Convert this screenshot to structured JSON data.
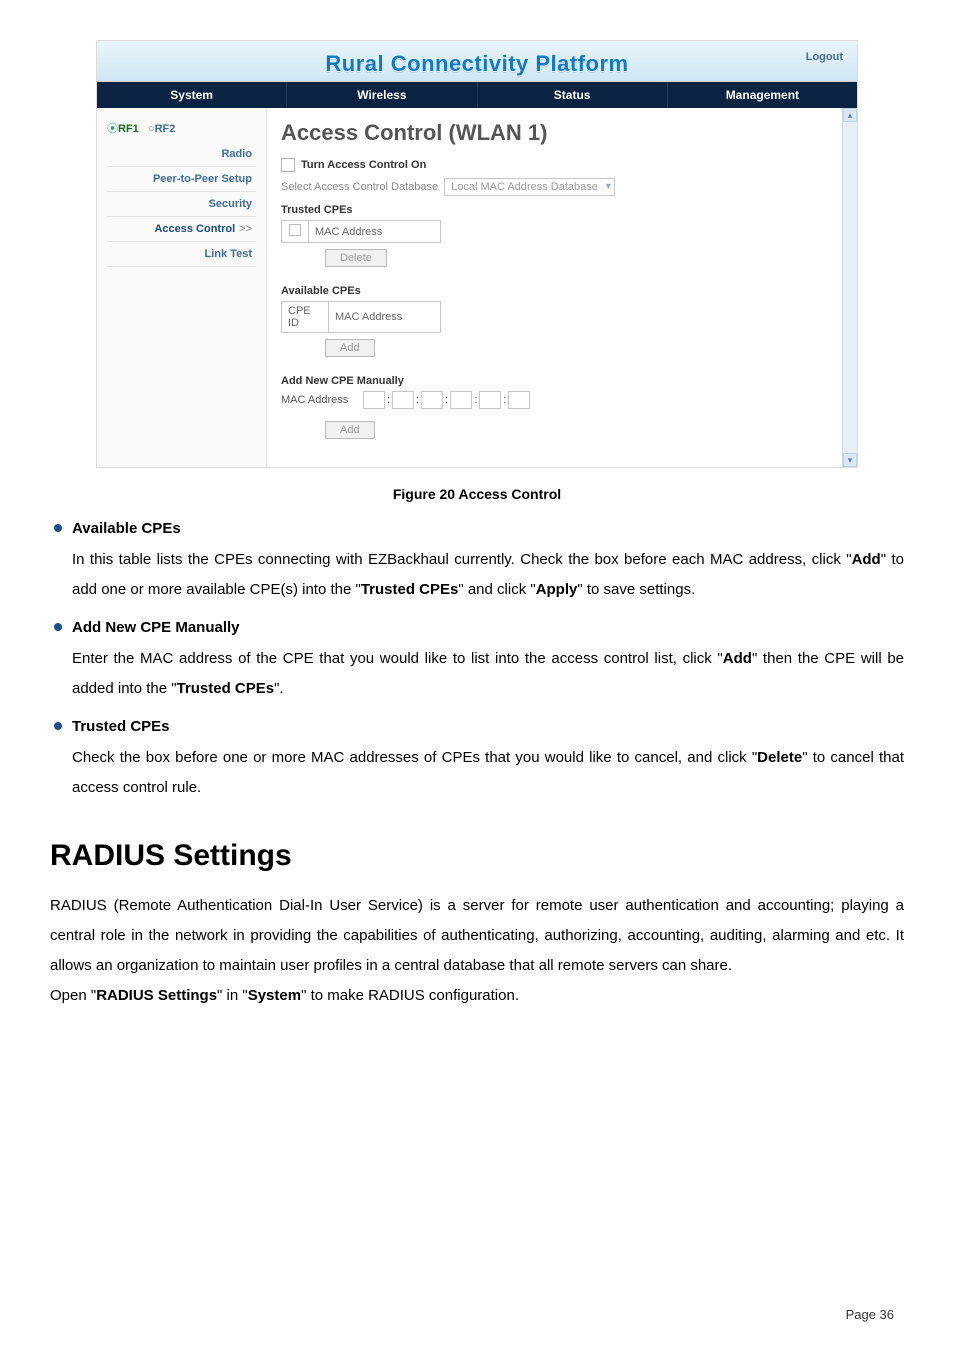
{
  "screenshot": {
    "brand": "Rural Connectivity Platform",
    "logout": "Logout",
    "tabs": {
      "system": "System",
      "wireless": "Wireless",
      "status": "Status",
      "management": "Management"
    },
    "sidebar": {
      "rf1": "RF1",
      "rf2": "RF2",
      "radio": "Radio",
      "p2p": "Peer-to-Peer Setup",
      "security": "Security",
      "access": "Access Control",
      "access_arrow": ">>",
      "link_test": "Link Test"
    },
    "main": {
      "title": "Access Control (WLAN 1)",
      "turn_on": "Turn Access Control On",
      "select_db_label": "Select Access Control Database",
      "select_db_value": "Local MAC Address Database",
      "trusted_label": "Trusted CPEs",
      "trusted_col": "MAC Address",
      "delete_btn": "Delete",
      "available_label": "Available CPEs",
      "avail_col1": "CPE ID",
      "avail_col2": "MAC Address",
      "add_btn": "Add",
      "manual_label": "Add New CPE Manually",
      "mac_label": "MAC Address",
      "add_btn2": "Add"
    }
  },
  "caption": "Figure 20 Access Control",
  "sections": {
    "avail": {
      "head": "Available CPEs",
      "body_1": "In this table lists the CPEs connecting with EZBackhaul currently. Check the box before each MAC address, click \"",
      "body_2": "Add",
      "body_3": "\" to add one or more available CPE(s) into the \"",
      "body_4": "Trusted CPEs",
      "body_5": "\" and click \"",
      "body_6": "Apply",
      "body_7": "\" to save settings."
    },
    "manual": {
      "head": "Add New CPE Manually",
      "body_1": "Enter the MAC address of the CPE that you would like to list into the access control list, click \"",
      "body_2": "Add",
      "body_3": "\" then the CPE will be added into the \"",
      "body_4": "Trusted CPEs",
      "body_5": "\"."
    },
    "trusted": {
      "head": "Trusted CPEs",
      "body_1": "Check the box before one or more MAC addresses of CPEs that you would like to cancel, and click \"",
      "body_2": "Delete",
      "body_3": "\" to cancel that access control rule."
    }
  },
  "radius": {
    "heading": "RADIUS Settings",
    "para1": "RADIUS (Remote Authentication Dial-In User Service) is a server for remote user authentication and accounting; playing a central role in the network in providing the capabilities of authenticating, authorizing, accounting, auditing, alarming and etc. It allows an organization to maintain user profiles in a central database that all remote servers can share.",
    "para2_1": "Open \"",
    "para2_2": "RADIUS Settings",
    "para2_3": "\" in \"",
    "para2_4": "System",
    "para2_5": "\" to make RADIUS configuration."
  },
  "page_number": "Page  36"
}
